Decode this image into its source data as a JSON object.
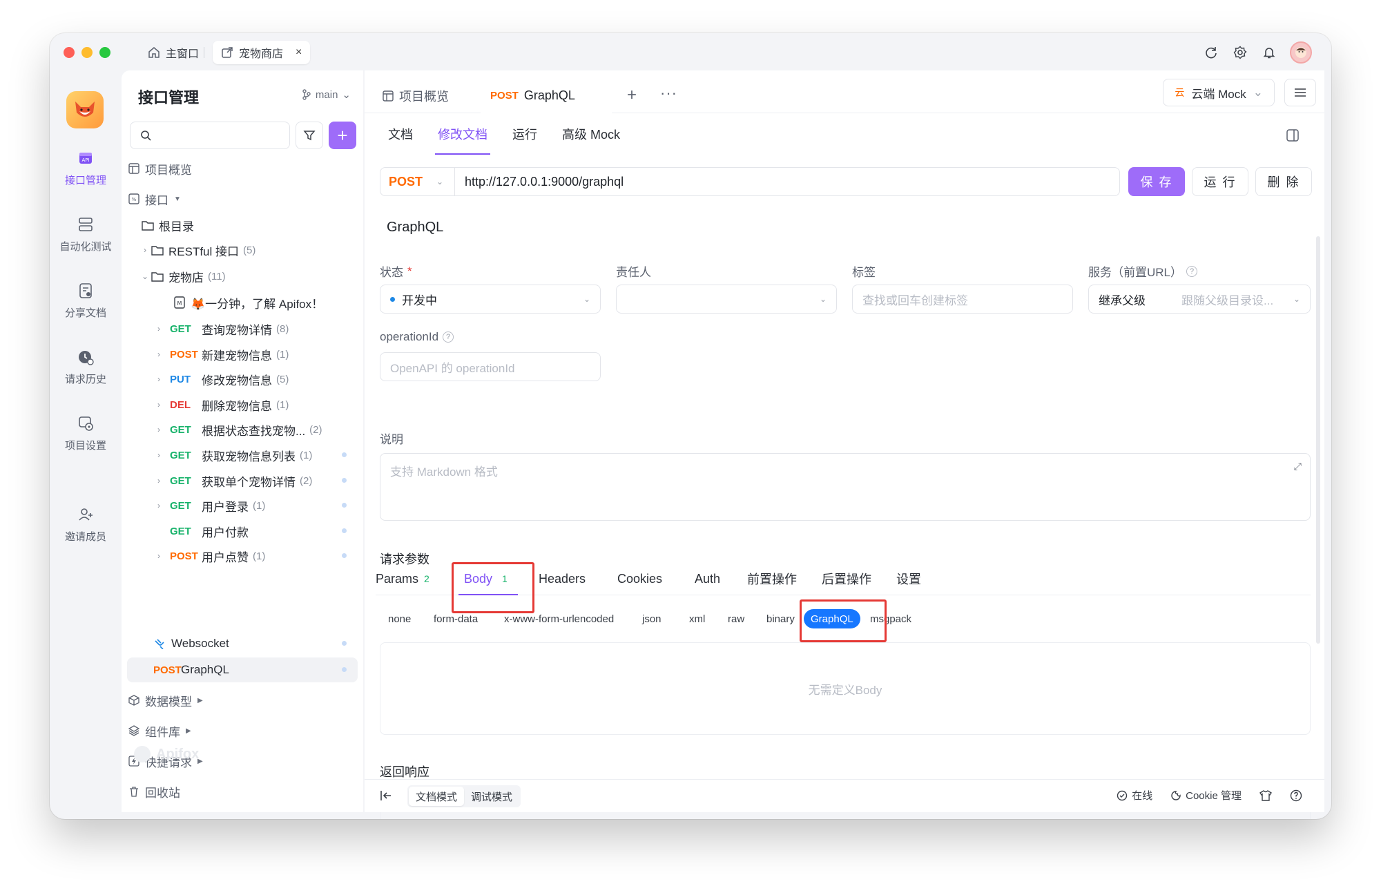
{
  "window": {
    "home_tab": "主窗口",
    "active_tab": "宠物商店",
    "close_glyph": "×"
  },
  "rail": [
    {
      "label": "接口管理",
      "icon": "api-icon",
      "active": true
    },
    {
      "label": "自动化测试",
      "icon": "automation-icon"
    },
    {
      "label": "分享文档",
      "icon": "share-doc-icon"
    },
    {
      "label": "请求历史",
      "icon": "history-icon"
    },
    {
      "label": "项目设置",
      "icon": "settings-icon"
    },
    {
      "label": "邀请成员",
      "icon": "invite-icon"
    }
  ],
  "sidebar": {
    "title": "接口管理",
    "branch": "main",
    "search_placeholder": "",
    "overview": "项目概览",
    "api_group": "接口",
    "root": "根目录",
    "restful": {
      "label": "RESTful 接口",
      "count": "(5)"
    },
    "petstore": {
      "label": "宠物店",
      "count": "(11)"
    },
    "intro_doc": "🦊一分钟，了解 Apifox！",
    "endpoints": [
      {
        "method": "GET",
        "cls": "get",
        "name": "查询宠物详情",
        "count": "(8)",
        "chev": true,
        "dot": false
      },
      {
        "method": "POST",
        "cls": "post",
        "name": "新建宠物信息",
        "count": "(1)",
        "chev": true,
        "dot": false
      },
      {
        "method": "PUT",
        "cls": "put",
        "name": "修改宠物信息",
        "count": "(5)",
        "chev": true,
        "dot": false
      },
      {
        "method": "DEL",
        "cls": "del",
        "name": "删除宠物信息",
        "count": "(1)",
        "chev": true,
        "dot": false
      },
      {
        "method": "GET",
        "cls": "get",
        "name": "根据状态查找宠物...",
        "count": "(2)",
        "chev": true,
        "dot": false
      },
      {
        "method": "GET",
        "cls": "get",
        "name": "获取宠物信息列表",
        "count": "(1)",
        "chev": true,
        "dot": true
      },
      {
        "method": "GET",
        "cls": "get",
        "name": "获取单个宠物详情",
        "count": "(2)",
        "chev": true,
        "dot": true
      },
      {
        "method": "GET",
        "cls": "get",
        "name": "用户登录",
        "count": "(1)",
        "chev": true,
        "dot": true
      },
      {
        "method": "GET",
        "cls": "get",
        "name": "用户付款",
        "count": "",
        "chev": false,
        "dot": true
      },
      {
        "method": "POST",
        "cls": "post",
        "name": "用户点赞",
        "count": "(1)",
        "chev": true,
        "dot": true
      }
    ],
    "websocket": "Websocket",
    "selected": {
      "method": "POST",
      "name": "GraphQL"
    },
    "data_model": "数据模型",
    "components": "组件库",
    "quick_request": "快捷请求",
    "recycle": "回收站",
    "watermark": "Apifox"
  },
  "main": {
    "tab_overview": "项目概览",
    "tab_active_method": "POST",
    "tab_active_name": "GraphQL",
    "mock_cloud": "云",
    "mock_label": "云端 Mock",
    "subtabs": [
      "文档",
      "修改文档",
      "运行",
      "高级 Mock"
    ],
    "url": {
      "method": "POST",
      "value": "http://127.0.0.1:9000/graphql"
    },
    "save": "保 存",
    "run": "运 行",
    "delete": "删 除",
    "api_name": "GraphQL",
    "status_label": "状态",
    "status_required": "*",
    "status_value": "开发中",
    "owner_label": "责任人",
    "tags_label": "标签",
    "tags_placeholder": "查找或回车创建标签",
    "service_label": "服务（前置URL）",
    "service_value": "继承父级",
    "service_hint": "跟随父级目录设...",
    "operation_label": "operationId",
    "operation_placeholder": "OpenAPI 的 operationId",
    "desc_label": "说明",
    "desc_placeholder": "支持 Markdown 格式",
    "params_title": "请求参数",
    "param_tabs": [
      {
        "label": "Params",
        "n": "2"
      },
      {
        "label": "Body",
        "n": "1"
      },
      {
        "label": "Headers",
        "n": ""
      },
      {
        "label": "Cookies",
        "n": ""
      },
      {
        "label": "Auth",
        "n": ""
      },
      {
        "label": "前置操作",
        "n": ""
      },
      {
        "label": "后置操作",
        "n": ""
      },
      {
        "label": "设置",
        "n": ""
      }
    ],
    "body_types": [
      "none",
      "form-data",
      "x-www-form-urlencoded",
      "json",
      "xml",
      "raw",
      "binary",
      "GraphQL",
      "msgpack"
    ],
    "body_empty": "无需定义Body",
    "response_title": "返回响应"
  },
  "bottom": {
    "doc_mode": "文档模式",
    "debug_mode": "调试模式",
    "online": "在线",
    "cookie": "Cookie 管理"
  },
  "colors": {
    "accent": "#8052f5",
    "get": "#17b26a",
    "post": "#ff6a00",
    "put": "#1e88e5",
    "del": "#e53935",
    "graphql_active": "#1677ff",
    "highlight_box": "#e53935"
  }
}
